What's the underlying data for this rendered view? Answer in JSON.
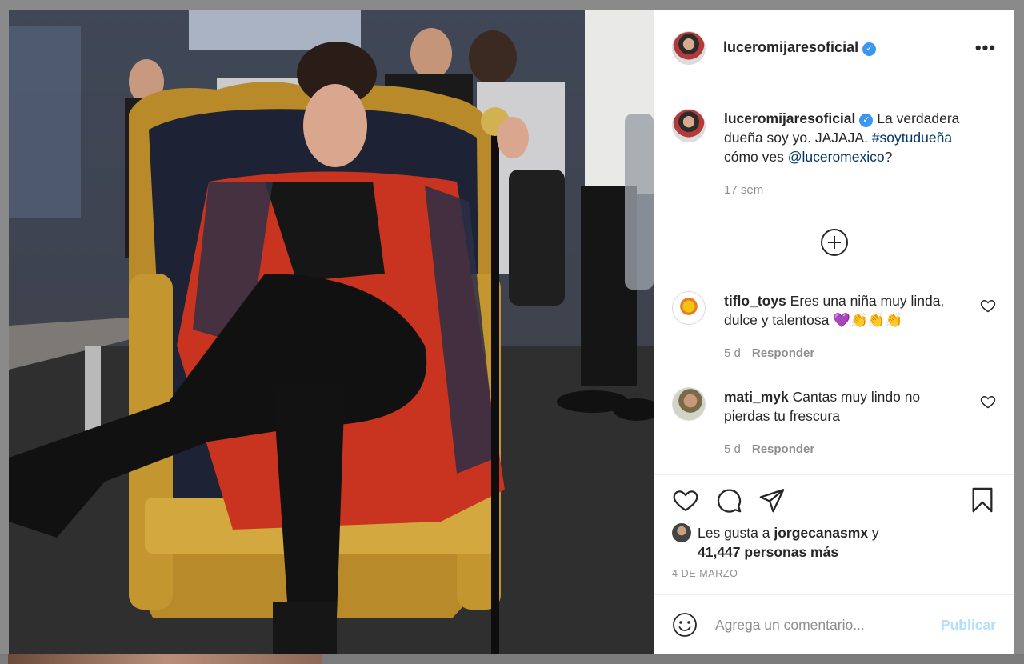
{
  "post": {
    "username": "luceromijaresoficial",
    "verified": true,
    "caption": {
      "text_before": "La verdadera dueña soy yo. JAJAJA. ",
      "hashtag": "#soytudueña",
      "text_middle": " cómo ves ",
      "mention": "@luceromexico",
      "text_after": "?"
    },
    "caption_time": "17 sem"
  },
  "comments": [
    {
      "username": "tiflo_toys",
      "text": "Eres una niña muy linda, dulce y talentosa 💜👏👏👏",
      "time": "5 d",
      "reply_label": "Responder"
    },
    {
      "username": "mati_myk",
      "text": "Cantas muy lindo no pierdas tu frescura",
      "time": "5 d",
      "reply_label": "Responder"
    }
  ],
  "likes": {
    "prefix": "Les gusta a ",
    "liker": "jorgecanasmx",
    "joiner": " y",
    "count_text": "41,447 personas más"
  },
  "date": "4 DE MARZO",
  "add_comment": {
    "placeholder": "Agrega un comentario...",
    "publish_label": "Publicar"
  },
  "icons": [
    "more-options-icon",
    "verified-badge-icon",
    "load-more-comments-icon",
    "heart-icon",
    "comment-icon",
    "share-icon",
    "bookmark-icon",
    "emoji-icon"
  ],
  "colors": {
    "verified": "#3897f0",
    "link": "#00376b",
    "publish_disabled": "#b2dffc",
    "secondary_text": "#8e8e8e"
  }
}
